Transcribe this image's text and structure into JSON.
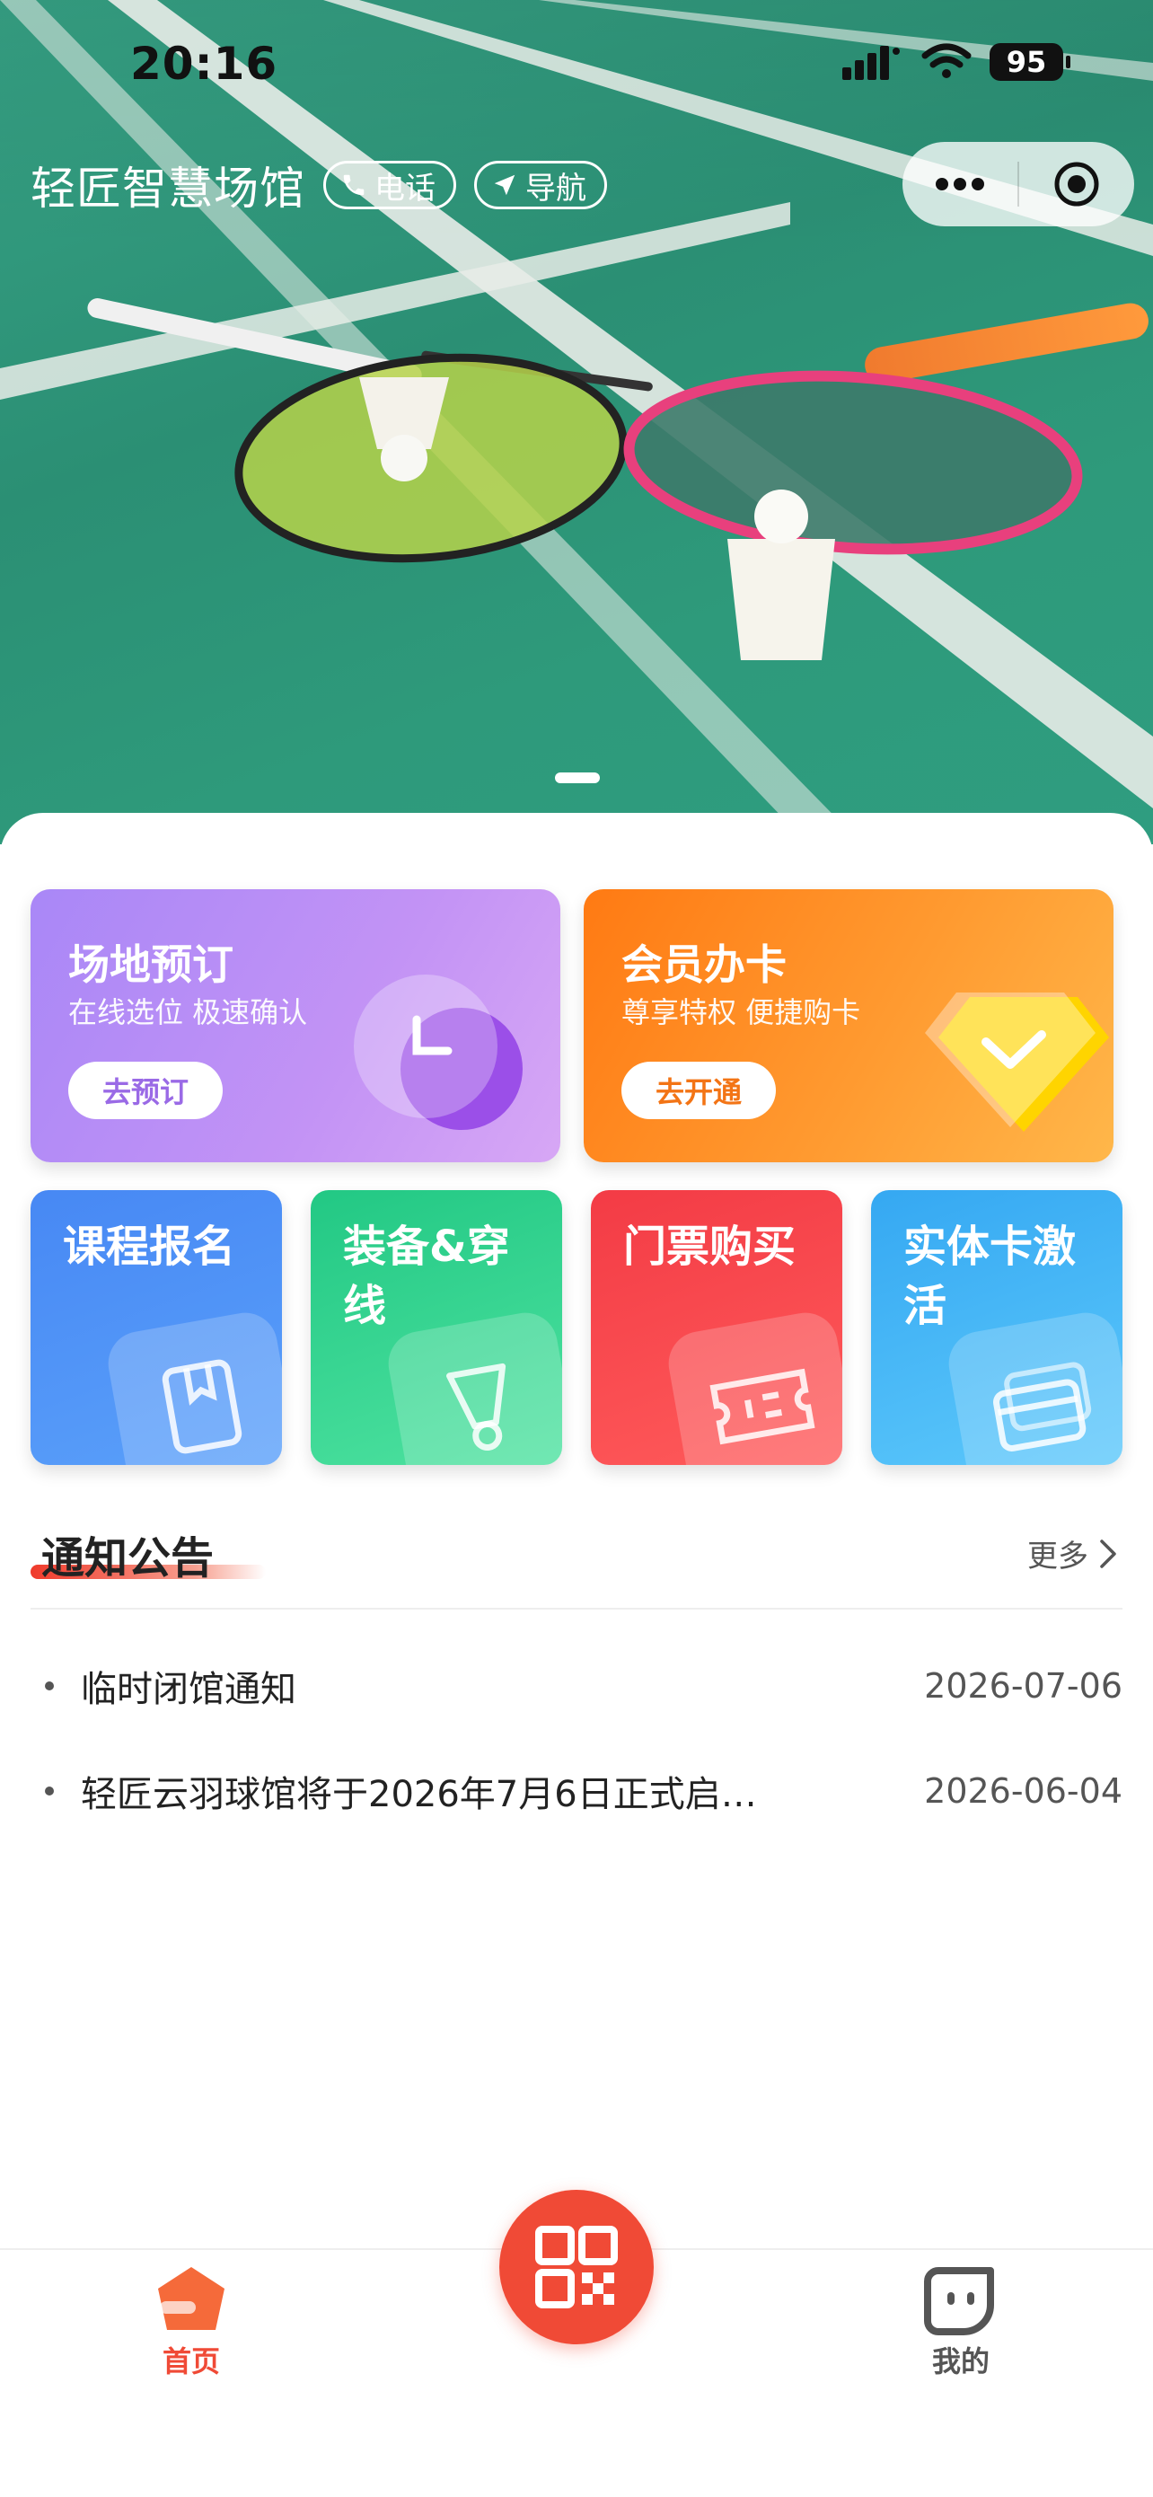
{
  "status_bar": {
    "time": "20:16",
    "battery": "95"
  },
  "header": {
    "venue_name": "轻匠智慧场馆",
    "phone_label": "电话",
    "nav_label": "导航"
  },
  "big_cards": [
    {
      "title": "场地预订",
      "subtitle": "在线选位 极速确认",
      "button": "去预订",
      "color": "#b07cf2"
    },
    {
      "title": "会员办卡",
      "subtitle": "尊享特权 便捷购卡",
      "button": "去开通",
      "color": "#ff8a20"
    }
  ],
  "small_cards": [
    {
      "title": "课程报名",
      "icon": "book-icon",
      "color": "#4b8ff7"
    },
    {
      "title": "装备&穿线",
      "icon": "shuttlecock-icon",
      "color": "#2ed08a"
    },
    {
      "title": "门票购买",
      "icon": "ticket-icon",
      "color": "#f5404a"
    },
    {
      "title": "实体卡激活",
      "icon": "card-icon",
      "color": "#3fb6f5"
    }
  ],
  "notices": {
    "heading": "通知公告",
    "more_label": "更多",
    "items": [
      {
        "title": "临时闭馆通知",
        "date": "2026-07-06"
      },
      {
        "title": "轻匠云羽球馆将于2026年7月6日正式启…",
        "date": "2026-06-04"
      }
    ]
  },
  "tabbar": {
    "home_label": "首页",
    "mine_label": "我的",
    "active_color": "#f04a36"
  }
}
